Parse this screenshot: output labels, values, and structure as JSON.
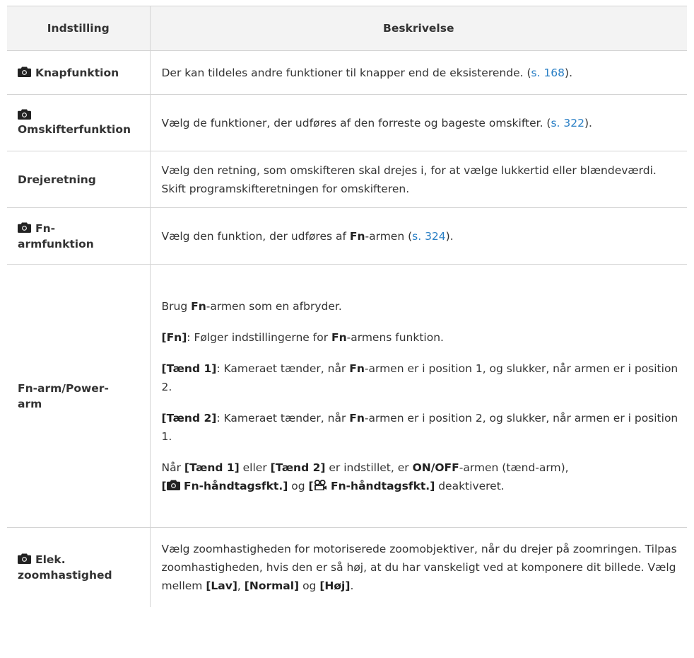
{
  "table": {
    "headers": [
      "Indstilling",
      "Beskrivelse"
    ],
    "rows": [
      {
        "name": "Knapfunktion",
        "desc_pre": "Der kan tildeles andre funktioner til knapper end de eksisterende. (",
        "ref": "s. 168",
        "desc_post": ")."
      },
      {
        "name": "Omskifterfunktion",
        "desc_pre": "Vælg de funktioner, der udføres af den forreste og bageste omskifter. (",
        "ref": "s. 322",
        "desc_post": ")."
      },
      {
        "name": "Drejeretning",
        "desc": "Vælg den retning, som omskifteren skal drejes i, for at vælge lukkertid eller blændeværdi. Skift programskifteretningen for omskifteren."
      },
      {
        "name_l1": "Fn-",
        "name_l2": "armfunktion",
        "desc_pre": "Vælg den funktion, der udføres af ",
        "fn": "Fn",
        "desc_mid": "-armen (",
        "ref": "s. 324",
        "desc_post": ")."
      },
      {
        "name_l1": "Fn-arm/Power-",
        "name_l2": "arm",
        "p1_pre": "Brug ",
        "p1_fn": "Fn",
        "p1_post": "-armen som en afbryder.",
        "p2_key": "[Fn]",
        "p2_mid": ": Følger indstillingerne for ",
        "p2_fn": "Fn",
        "p2_post": "-armens funktion.",
        "p3_key": "[Tænd 1]",
        "p3_mid": ": Kameraet tænder, når ",
        "p3_fn": "Fn",
        "p3_post": "-armen er i position 1, og slukker, når armen er i position 2.",
        "p4_key": "[Tænd 2]",
        "p4_mid": ": Kameraet tænder, når ",
        "p4_fn": "Fn",
        "p4_post": "-armen er i position 2, og slukker, når armen er i position 1.",
        "p5_pre": "Når ",
        "p5_k1": "[Tænd 1]",
        "p5_or": " eller ",
        "p5_k2": "[Tænd 2]",
        "p5_mid": " er indstillet, er ",
        "p5_onoff": "ON/OFF",
        "p5_mid2": "-armen (tænd-arm),",
        "p5_k3_open": "[",
        "p5_k3_text": " Fn-håndtagsfkt.]",
        "p5_og": " og ",
        "p5_k4_open": "[",
        "p5_k4_text": " Fn-håndtagsfkt.]",
        "p5_end": " deaktiveret."
      },
      {
        "name_l1": "Elek.",
        "name_l2": "zoomhastighed",
        "desc_pre": "Vælg zoomhastigheden for motoriserede zoomobjektiver, når du drejer på zoomringen. Tilpas zoomhastigheden, hvis den er så høj, at du har vanskeligt ved at komponere dit billede. Vælg mellem ",
        "k1": "[Lav]",
        "sep": ", ",
        "k2": "[Normal]",
        "og": " og ",
        "k3": "[Høj]",
        "end": "."
      }
    ]
  },
  "icons": {
    "camera": "camera-icon",
    "video": "video-camera-icon"
  },
  "colors": {
    "link": "#2a7fc5",
    "header_bg": "#f3f3f3",
    "border": "#d4d4d4",
    "text": "#333333"
  }
}
